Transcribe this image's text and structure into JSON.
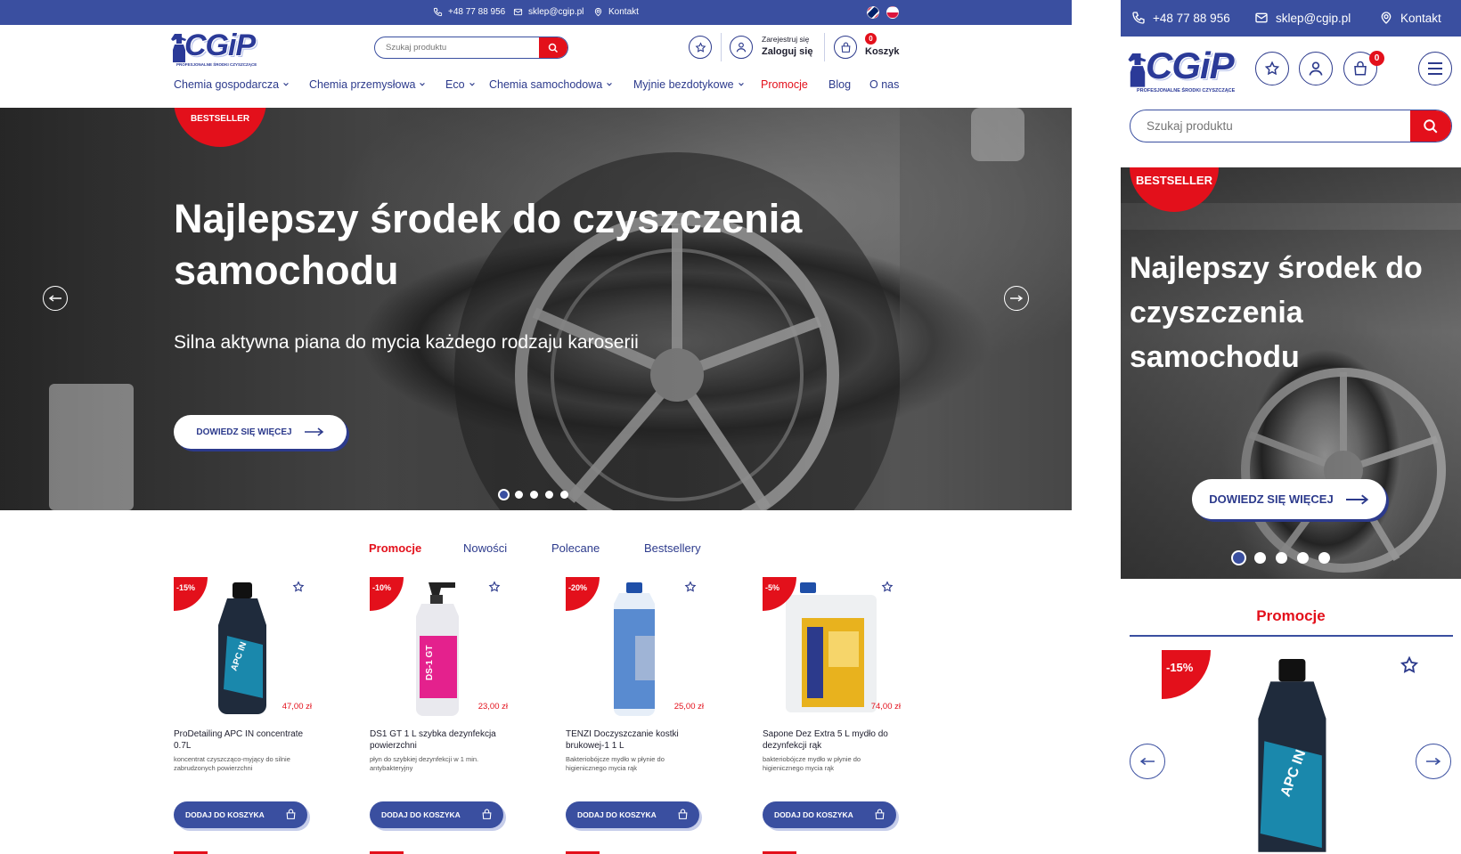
{
  "topbar": {
    "phone": "+48 77 88 956",
    "email": "sklep@cgip.pl",
    "contact": "Kontakt"
  },
  "logo": {
    "name": "CGiP",
    "tagline": "PROFESJONALNE ŚRODKI CZYSZCZĄCE"
  },
  "search": {
    "placeholder": "Szukaj produktu"
  },
  "account": {
    "register": "Zarejestruj się",
    "login": "Zaloguj się"
  },
  "cart": {
    "label": "Koszyk",
    "count": "0"
  },
  "nav": [
    {
      "label": "Chemia gospodarcza"
    },
    {
      "label": "Chemia przemysłowa"
    },
    {
      "label": "Eco"
    },
    {
      "label": "Chemia samochodowa"
    },
    {
      "label": "Myjnie bezdotykowe"
    },
    {
      "label": "Promocje"
    },
    {
      "label": "Blog"
    },
    {
      "label": "O nas"
    }
  ],
  "hero": {
    "badge": "BESTSELLER",
    "title": "Najlepszy środek do czyszczenia samochodu",
    "subtitle": "Silna aktywna piana do mycia każdego rodzaju karoserii",
    "cta": "DOWIEDZ SIĘ WIĘCEJ",
    "slides": 5,
    "active_slide": 1
  },
  "tabs": [
    {
      "label": "Promocje"
    },
    {
      "label": "Nowości"
    },
    {
      "label": "Polecane"
    },
    {
      "label": "Bestsellery"
    }
  ],
  "products": [
    {
      "discount": "-15%",
      "price": "47,00 zł",
      "name": "ProDetailing APC IN concentrate 0.7L",
      "desc": "koncentrat czyszcząco-myjący do silnie zabrudzonych powierzchni",
      "add": "DODAJ DO KOSZYKA",
      "bottle_color": "#1f2b3c",
      "label_color": "#19a0c8"
    },
    {
      "discount": "-10%",
      "price": "23,00 zł",
      "name": "DS1 GT 1 L szybka dezynfekcja powierzchni",
      "desc": "płyn do szybkiej dezynfekcji w 1 min. antybakteryjny",
      "add": "DODAJ DO KOSZYKA",
      "bottle_color": "#e9e9ee",
      "label_color": "#e4218d"
    },
    {
      "discount": "-20%",
      "price": "25,00 zł",
      "name": "TENZI Doczyszczanie kostki brukowej-1 1 L",
      "desc": "Bakteriobójcze mydło w płynie do higienicznego mycia rąk",
      "add": "DODAJ DO KOSZYKA",
      "bottle_color": "#e6eef8",
      "label_color": "#3f79c9"
    },
    {
      "discount": "-5%",
      "price": "74,00 zł",
      "name": "Sapone Dez Extra 5 L mydło do dezynfekcji rąk",
      "desc": "bakteriobójcze mydło w płynie do higienicznego mycia rąk",
      "add": "DODAJ DO KOSZYKA",
      "bottle_color": "#eef0f2",
      "label_color": "#e8b21e"
    }
  ],
  "mobile": {
    "section_title": "Promocje",
    "product_discount": "-15%"
  },
  "colors": {
    "primary": "#3a4fa0",
    "accent": "#e3101b"
  },
  "icons": [
    "phone-icon",
    "mail-icon",
    "location-icon",
    "star-icon",
    "user-icon",
    "bag-icon",
    "search-icon",
    "menu-icon",
    "arrow-left-icon",
    "arrow-right-icon",
    "chevron-down-icon"
  ]
}
